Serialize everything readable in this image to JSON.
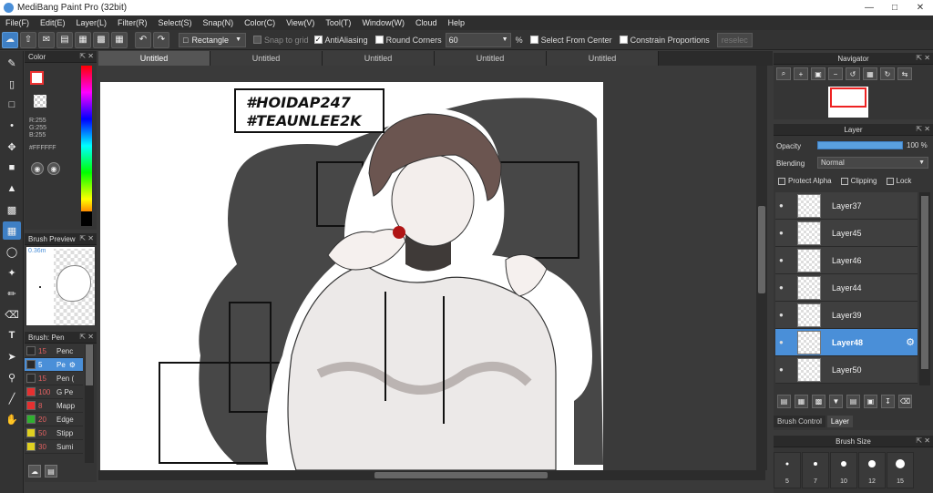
{
  "window": {
    "title": "MediBang Paint Pro (32bit)"
  },
  "menu": [
    "File(F)",
    "Edit(E)",
    "Layer(L)",
    "Filter(R)",
    "Select(S)",
    "Snap(N)",
    "Color(C)",
    "View(V)",
    "Tool(T)",
    "Window(W)",
    "Cloud",
    "Help"
  ],
  "toolbar": {
    "shape": "Rectangle",
    "snap_to_grid": "Snap to grid",
    "antialiasing": "AntiAliasing",
    "round_corners": "Round Corners",
    "round_value": "60",
    "percent": "%",
    "select_from_center": "Select From Center",
    "constrain": "Constrain Proportions",
    "reselect": "reselec"
  },
  "tabs": [
    "Untitled",
    "Untitled",
    "Untitled",
    "Untitled",
    "Untitled"
  ],
  "color_panel": {
    "title": "Color",
    "r": "R:255",
    "g": "G:255",
    "b": "B:255",
    "hex": "#FFFFFF",
    "fg_color": "#ffffff"
  },
  "brush_preview": {
    "title": "Brush Preview",
    "size": "0.36m"
  },
  "brush_panel": {
    "title": "Brush: Pen",
    "items": [
      {
        "size": "15",
        "name": "Penc",
        "color": "#2a2a2a"
      },
      {
        "size": "5",
        "name": "Pe",
        "color": "#2a2a2a"
      },
      {
        "size": "15",
        "name": "Pen (",
        "color": "#2a2a2a"
      },
      {
        "size": "100",
        "name": "G Pe",
        "color": "#e53030"
      },
      {
        "size": "8",
        "name": "Mapp",
        "color": "#e53030"
      },
      {
        "size": "20",
        "name": "Edge",
        "color": "#30b030"
      },
      {
        "size": "50",
        "name": "Stipp",
        "color": "#e0d020"
      },
      {
        "size": "30",
        "name": "Sumi",
        "color": "#e0d020"
      }
    ]
  },
  "canvas": {
    "text_line1": "#HOIDAP247",
    "text_line2": "#TEAUNLEE2K"
  },
  "navigator": {
    "title": "Navigator"
  },
  "layer_panel": {
    "title": "Layer",
    "opacity_label": "Opacity",
    "opacity_value": "100 %",
    "blending_label": "Blending",
    "blending_value": "Normal",
    "protect_alpha": "Protect Alpha",
    "clipping": "Clipping",
    "lock": "Lock",
    "layers": [
      "Layer37",
      "Layer45",
      "Layer46",
      "Layer44",
      "Layer39",
      "Layer48",
      "Layer50"
    ],
    "selected_layer": "Layer48",
    "tab_brush_control": "Brush Control",
    "tab_layer": "Layer"
  },
  "brush_size": {
    "title": "Brush Size",
    "sizes": [
      "5",
      "7",
      "10",
      "12",
      "15"
    ]
  }
}
